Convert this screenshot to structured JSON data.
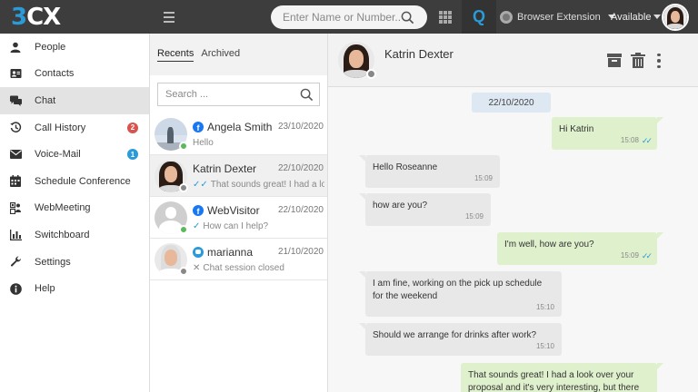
{
  "app": {
    "logo_text": "3CX"
  },
  "topbar": {
    "search_placeholder": "Enter Name or Number...",
    "q_label": "Q",
    "extension_label": "Browser Extension",
    "status_label": "Available"
  },
  "sidebar": {
    "items": [
      {
        "label": "People",
        "icon": "person-icon"
      },
      {
        "label": "Contacts",
        "icon": "contact-card-icon"
      },
      {
        "label": "Chat",
        "icon": "chat-bubbles-icon"
      },
      {
        "label": "Call History",
        "icon": "history-icon",
        "badge": "2"
      },
      {
        "label": "Voice-Mail",
        "icon": "envelope-icon",
        "badge": "1"
      },
      {
        "label": "Schedule Conference",
        "icon": "calendar-icon"
      },
      {
        "label": "WebMeeting",
        "icon": "webmeeting-icon"
      },
      {
        "label": "Switchboard",
        "icon": "bar-chart-icon"
      },
      {
        "label": "Settings",
        "icon": "wrench-icon"
      },
      {
        "label": "Help",
        "icon": "info-icon"
      }
    ]
  },
  "list": {
    "tabs": {
      "recents": "Recents",
      "archived": "Archived"
    },
    "search_placeholder": "Search ...",
    "conversations": [
      {
        "name": "Angela Smith",
        "date": "23/10/2020",
        "preview": "Hello",
        "source": "facebook",
        "status": "online"
      },
      {
        "name": "Katrin Dexter",
        "date": "22/10/2020",
        "preview": "That sounds great! I had a look over",
        "source": "",
        "status": "away",
        "read": true
      },
      {
        "name": "WebVisitor",
        "date": "22/10/2020",
        "preview": "How can I help?",
        "source": "facebook",
        "status": "online",
        "read": true
      },
      {
        "name": "marianna",
        "date": "21/10/2020",
        "preview": "Chat session closed",
        "source": "webchat",
        "status": "away",
        "closed": true
      }
    ]
  },
  "chat": {
    "contact_name": "Katrin Dexter",
    "date": "22/10/2020",
    "messages": [
      {
        "dir": "out",
        "text": "Hi Katrin",
        "time": "15:08"
      },
      {
        "dir": "in",
        "text": "Hello Roseanne",
        "time": "15:09"
      },
      {
        "dir": "in",
        "text": "how are you?",
        "time": "15:09"
      },
      {
        "dir": "out",
        "text": "I'm well, how are you?",
        "time": "15:09"
      },
      {
        "dir": "in",
        "text": "I am fine, working on the pick up schedule for the weekend",
        "time": "15:10"
      },
      {
        "dir": "in",
        "text": "Should we arrange for drinks after work?",
        "time": "15:10"
      },
      {
        "dir": "out",
        "text": "That sounds great! I had a look over your proposal and it's very interesting, but there",
        "time": ""
      }
    ]
  }
}
